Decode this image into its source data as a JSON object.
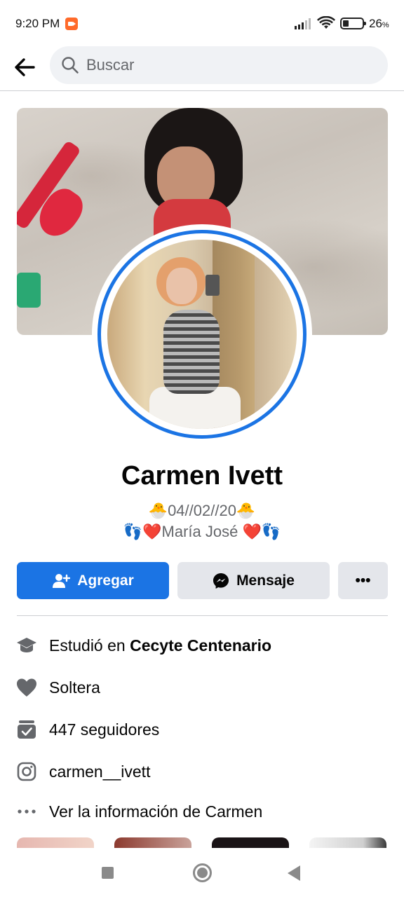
{
  "status_bar": {
    "time": "9:20 PM",
    "battery": "26",
    "battery_unit": "%"
  },
  "header": {
    "search_placeholder": "Buscar"
  },
  "profile": {
    "name": "Carmen Ivett",
    "bio_line_1": "🐣04//02//20🐣",
    "bio_line_2": "👣❤️María José ❤️👣"
  },
  "actions": {
    "add_label": "Agregar",
    "message_label": "Mensaje",
    "more_label": "•••"
  },
  "info": {
    "studied_prefix": "Estudió en ",
    "studied_school": "Cecyte Centenario",
    "relationship": "Soltera",
    "followers": "447 seguidores",
    "instagram": "carmen__ivett",
    "see_info": "Ver la información de Carmen"
  },
  "colors": {
    "accent": "#1b74e4",
    "secondary_button": "#e4e6eb",
    "icon_gray": "#65676b"
  }
}
